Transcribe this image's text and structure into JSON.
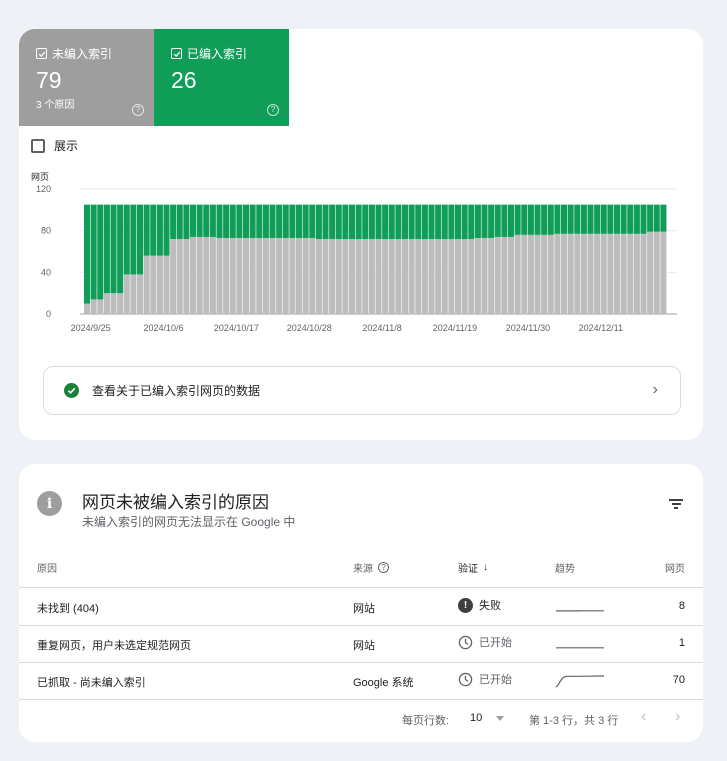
{
  "summary": {
    "not_indexed": {
      "label": "未编入索引",
      "count": "79",
      "sub": "3 个原因",
      "color": "#9e9e9e"
    },
    "indexed": {
      "label": "已编入索引",
      "count": "26",
      "color": "#0f9d58"
    },
    "help_glyph": "?"
  },
  "show_label": "展示",
  "chart_data": {
    "type": "bar",
    "stacked": true,
    "ylabel": "网页",
    "ylim": [
      0,
      120
    ],
    "yticks": [
      0,
      40,
      80,
      120
    ],
    "x_tick_labels": [
      "2024/9/25",
      "2024/10/6",
      "2024/10/17",
      "2024/10/28",
      "2024/11/8",
      "2024/11/19",
      "2024/11/30",
      "2024/12/11"
    ],
    "x_tick_indices": [
      1,
      12,
      23,
      34,
      45,
      56,
      67,
      78
    ],
    "grid": true,
    "legend": "none",
    "series": [
      {
        "name": "未编入索引",
        "color": "#bdbdbd",
        "values": [
          10,
          14,
          14,
          20,
          20,
          20,
          38,
          38,
          38,
          56,
          56,
          56,
          56,
          72,
          72,
          72,
          74,
          74,
          74,
          74,
          73,
          73,
          73,
          73,
          73,
          73,
          73,
          73,
          73,
          73,
          73,
          73,
          73,
          73,
          73,
          72,
          72,
          72,
          72,
          72,
          72,
          72,
          72,
          72,
          72,
          72,
          72,
          72,
          72,
          72,
          72,
          72,
          72,
          72,
          72,
          72,
          72,
          72,
          72,
          73,
          73,
          73,
          74,
          74,
          74,
          76,
          76,
          76,
          76,
          76,
          76,
          77,
          77,
          77,
          77,
          77,
          77,
          77,
          77,
          77,
          77,
          77,
          77,
          77,
          77,
          79,
          79,
          79
        ]
      },
      {
        "name": "已编入索引",
        "color": "#0f9d58",
        "values": [
          95,
          91,
          91,
          85,
          85,
          85,
          67,
          67,
          67,
          49,
          49,
          49,
          49,
          33,
          33,
          33,
          31,
          31,
          31,
          31,
          32,
          32,
          32,
          32,
          32,
          32,
          32,
          32,
          32,
          32,
          32,
          32,
          32,
          32,
          32,
          33,
          33,
          33,
          33,
          33,
          33,
          33,
          33,
          33,
          33,
          33,
          33,
          33,
          33,
          33,
          33,
          33,
          33,
          33,
          33,
          33,
          33,
          33,
          33,
          32,
          32,
          32,
          31,
          31,
          31,
          29,
          29,
          29,
          29,
          29,
          29,
          28,
          28,
          28,
          28,
          28,
          28,
          28,
          28,
          28,
          28,
          28,
          28,
          28,
          28,
          26,
          26,
          26
        ]
      }
    ]
  },
  "data_link": {
    "label": "查看关于已编入索引网页的数据",
    "chevron": "›"
  },
  "reasons": {
    "info_glyph": "i",
    "title": "网页未被编入索引的原因",
    "subtitle": "未编入索引的网页无法显示在 Google 中",
    "headers": {
      "reason": "原因",
      "source": "来源",
      "validation": "验证",
      "sort_glyph": "↓",
      "trend": "趋势",
      "pages": "网页"
    },
    "rows": [
      {
        "reason": "未找到 (404)",
        "source": "网站",
        "validation": "失败",
        "status": "failed",
        "pages": "8",
        "trend": [
          8,
          8,
          8,
          8,
          8,
          8,
          8,
          8,
          8,
          8,
          8,
          8,
          8,
          9,
          9,
          9,
          9,
          9,
          9,
          9,
          9,
          9,
          9,
          9,
          9,
          9
        ]
      },
      {
        "reason": "重复网页，用户未选定规范网页",
        "source": "网站",
        "validation": "已开始",
        "status": "started",
        "pages": "1",
        "trend": [
          1,
          1,
          1,
          1,
          1,
          1,
          1,
          1,
          1,
          1,
          1,
          1,
          1,
          1,
          1,
          1,
          1,
          1,
          1,
          1,
          1,
          1,
          1,
          1,
          1,
          1
        ]
      },
      {
        "reason": "已抓取 - 尚未编入索引",
        "source": "Google 系统",
        "validation": "已开始",
        "status": "started",
        "pages": "70",
        "trend": [
          0,
          10,
          30,
          50,
          60,
          65,
          66,
          66,
          66,
          66,
          66,
          66,
          66,
          66,
          67,
          67,
          67,
          67,
          67,
          67,
          68,
          68,
          68,
          68,
          68,
          68
        ]
      }
    ]
  },
  "pager": {
    "rows_label": "每页行数:",
    "rows_value": "10",
    "range": "第 1-3 行，共 3 行",
    "prev": "‹",
    "next": "›"
  }
}
